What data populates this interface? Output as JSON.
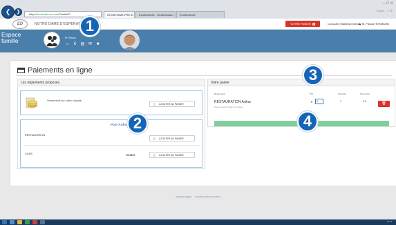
{
  "browser": {
    "address_prefix": "https://",
    "address_domain": "ecoledirecte.com",
    "address_path": "/Famille/F...",
    "tabs": [
      "57478 RAME.PRE 4t",
      "EcoleDirecte - Gestionnaire...",
      "EcoleDirecte"
    ],
    "window_controls": "— ☐ ✕",
    "right_tools": "Ecole... ☆ ⚙"
  },
  "header": {
    "logo_text": "ED",
    "school_name": "NOTRE DAME D'ESPERAN",
    "account_button": "VOTRE PANIER",
    "account_badge": "1",
    "link_finances": "Consulter Etablissements",
    "link_user": "M. Pascal HERMANN"
  },
  "bar": {
    "space_title_1": "Espace",
    "space_title_2": "famille",
    "parent_label": "M. Pascal"
  },
  "page": {
    "title": "Paiements en ligne"
  },
  "left_panel": {
    "heading": "Les règlements proposés",
    "deposit_text": "Versement sur votre compte",
    "add_label": "AJOUTER AU PANIER",
    "child_heading": "Pour Arthur",
    "rows": [
      {
        "label": "RESTAURATION",
        "price": ""
      },
      {
        "label": "COUS",
        "price": "70.00 €"
      }
    ]
  },
  "right_panel": {
    "heading": "Votre panier",
    "col_reglements": "Règlements",
    "col_prix": "Prix",
    "col_quantite": "Quantité",
    "col_sous_total": "Sous-total",
    "item_name": "RESTAURATION Arthur",
    "item_sub": "Vous pouvez choisir le montant",
    "currency": "€",
    "qty_value": "0",
    "qty_display": "1",
    "subtotal": "0.0"
  },
  "footer": {
    "link_1": "Mentions légales",
    "link_2": "Consulter la documentation"
  },
  "taskbar": {
    "time": "14:21"
  },
  "markers": [
    "1",
    "2",
    "3",
    "4"
  ]
}
